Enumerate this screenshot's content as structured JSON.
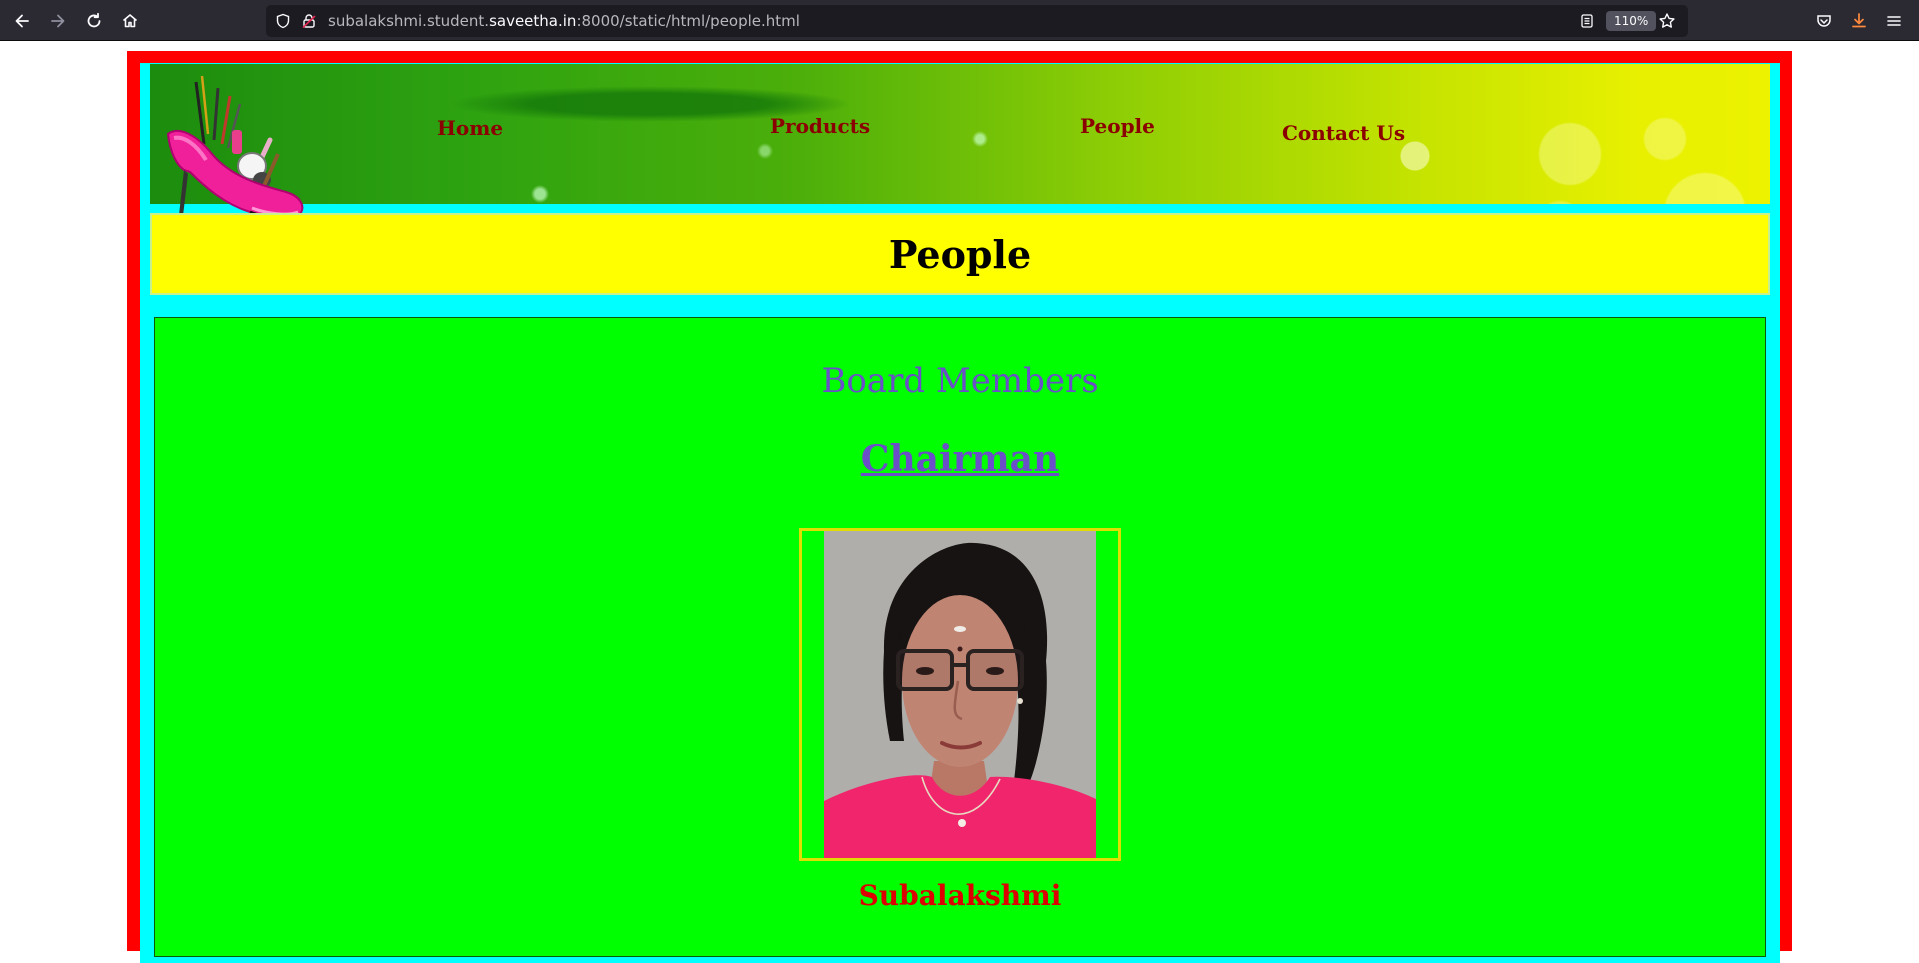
{
  "browser": {
    "url_prefix": "subalakshmi.student.",
    "url_domain": "saveetha.in",
    "url_suffix": ":8000/static/html/people.html",
    "zoom": "110%"
  },
  "nav": {
    "home": "Home",
    "products": "Products",
    "people": "People",
    "contact": "Contact Us"
  },
  "page": {
    "title": "People",
    "section_title": "Board Members",
    "role": "Chairman",
    "member_name": "Subalakshmi"
  },
  "colors": {
    "outer_frame": "#ff0000",
    "inner_frame": "#00ffff",
    "title_bar": "#ffff00",
    "content_bg": "#00ff00",
    "nav_text": "#8b0000",
    "heading_purple": "#6a4fc8",
    "name_red": "#dc0000"
  }
}
